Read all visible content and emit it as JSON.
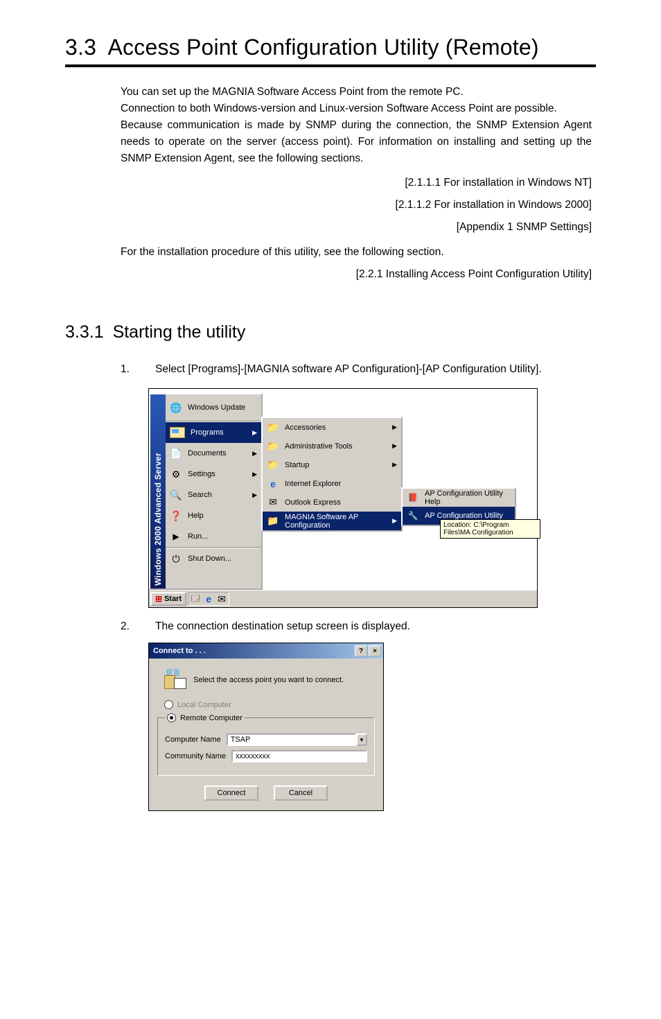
{
  "heading": {
    "num": "3.3",
    "title": "Access Point Configuration Utility (Remote)"
  },
  "intro": {
    "p1": "You can set up the MAGNIA Software Access Point from the remote PC.",
    "p2": "Connection to both Windows-version and Linux-version Software Access Point are possible.",
    "p3": "Because communication is made by SNMP during the connection, the SNMP Extension Agent needs to operate on the server (access point).  For information on installing and setting up the SNMP Extension Agent, see the following sections."
  },
  "refs": {
    "r1": "[2.1.1.1   For installation in Windows NT]",
    "r2": "[2.1.1.2 For installation in Windows 2000]",
    "r3": "[Appendix 1   SNMP Settings]"
  },
  "intro2": "For the installation procedure of this utility, see the following section.",
  "ref4": "[2.2.1 Installing Access Point Configuration Utility]",
  "sub": {
    "num": "3.3.1",
    "title": "Starting the utility"
  },
  "steps": {
    "s1n": "1.",
    "s1": "Select [Programs]-[MAGNIA software AP Configuration]-[AP Configuration Utility].",
    "s2n": "2.",
    "s2": "The connection destination setup screen is displayed."
  },
  "start": {
    "banner": "Windows 2000 Advanced Server",
    "topitem": "Windows Update",
    "items": {
      "programs": "Programs",
      "documents": "Documents",
      "settings": "Settings",
      "search": "Search",
      "help": "Help",
      "run": "Run...",
      "shutdown": "Shut Down..."
    },
    "sub1": {
      "accessories": "Accessories",
      "admintools": "Administrative Tools",
      "startup": "Startup",
      "ie": "Internet Explorer",
      "oe": "Outlook Express",
      "magnia": "MAGNIA Software AP Configuration"
    },
    "sub2": {
      "help": "AP Configuration Utility Help",
      "util": "AP Configuration Utility"
    },
    "tooltip": "Location: C:\\Program Files\\MA Configuration",
    "startbtn": "Start"
  },
  "dialog": {
    "title": "Connect to . . .",
    "helpbtn": "?",
    "closebtn": "×",
    "prompt": "Select the access point you want to connect.",
    "local": "Local Computer",
    "remote": "Remote Computer",
    "cname_label": "Computer Name",
    "cname_value": "TSAP",
    "comm_label": "Community Name",
    "comm_value": "xxxxxxxxx",
    "connect": "Connect",
    "cancel": "Cancel"
  }
}
